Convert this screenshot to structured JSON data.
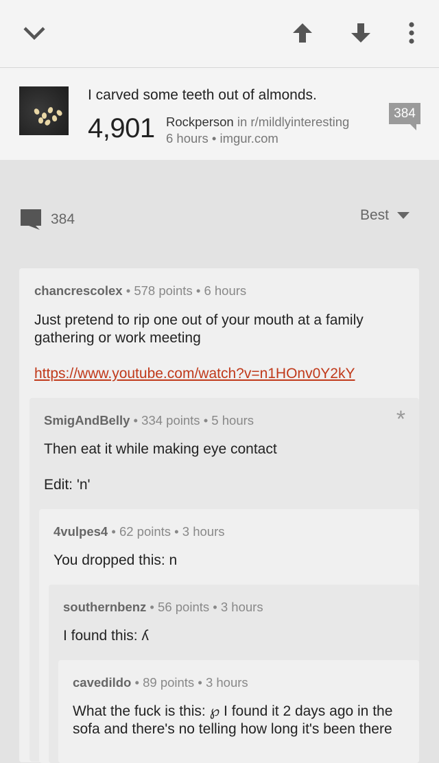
{
  "toolbar": {
    "collapse_icon": "chevron-down-icon",
    "upvote_icon": "arrow-up-icon",
    "downvote_icon": "arrow-down-icon",
    "menu_icon": "kebab-menu-icon"
  },
  "post": {
    "title": "I carved some teeth out of almonds.",
    "score": "4,901",
    "author": "Rockperson",
    "subreddit_text": " in r/mildlyinteresting",
    "age_domain": "6 hours • imgur.com",
    "comment_badge": "384"
  },
  "comments_bar": {
    "count": "384",
    "sort": "Best"
  },
  "comments": [
    {
      "user": "chancrescolex",
      "meta": " • 578 points • 6 hours",
      "body": "Just pretend to rip one out of your mouth at a family gathering or work meeting",
      "link": "https://www.youtube.com/watch?v=n1HOnv0Y2kY"
    },
    {
      "user": "SmigAndBelly",
      "meta": " • 334 points • 5 hours",
      "body": "Then eat it while making eye contact",
      "body2": "Edit: 'n'",
      "star": "*"
    },
    {
      "user": "4vulpes4",
      "meta": " • 62 points • 3 hours",
      "body": "You dropped this: n"
    },
    {
      "user": "southernbenz",
      "meta": " • 56 points • 3 hours",
      "body": "I found this: ʎ"
    },
    {
      "user": "cavedildo",
      "meta": " • 89 points • 3 hours",
      "body": "What the fuck is this: ℘ I found it 2 days ago in the sofa and there's no telling how long it's been there"
    }
  ],
  "colors": {
    "link": "#c0391a",
    "background": "#e3e3e3",
    "card": "#f0f0f0"
  }
}
